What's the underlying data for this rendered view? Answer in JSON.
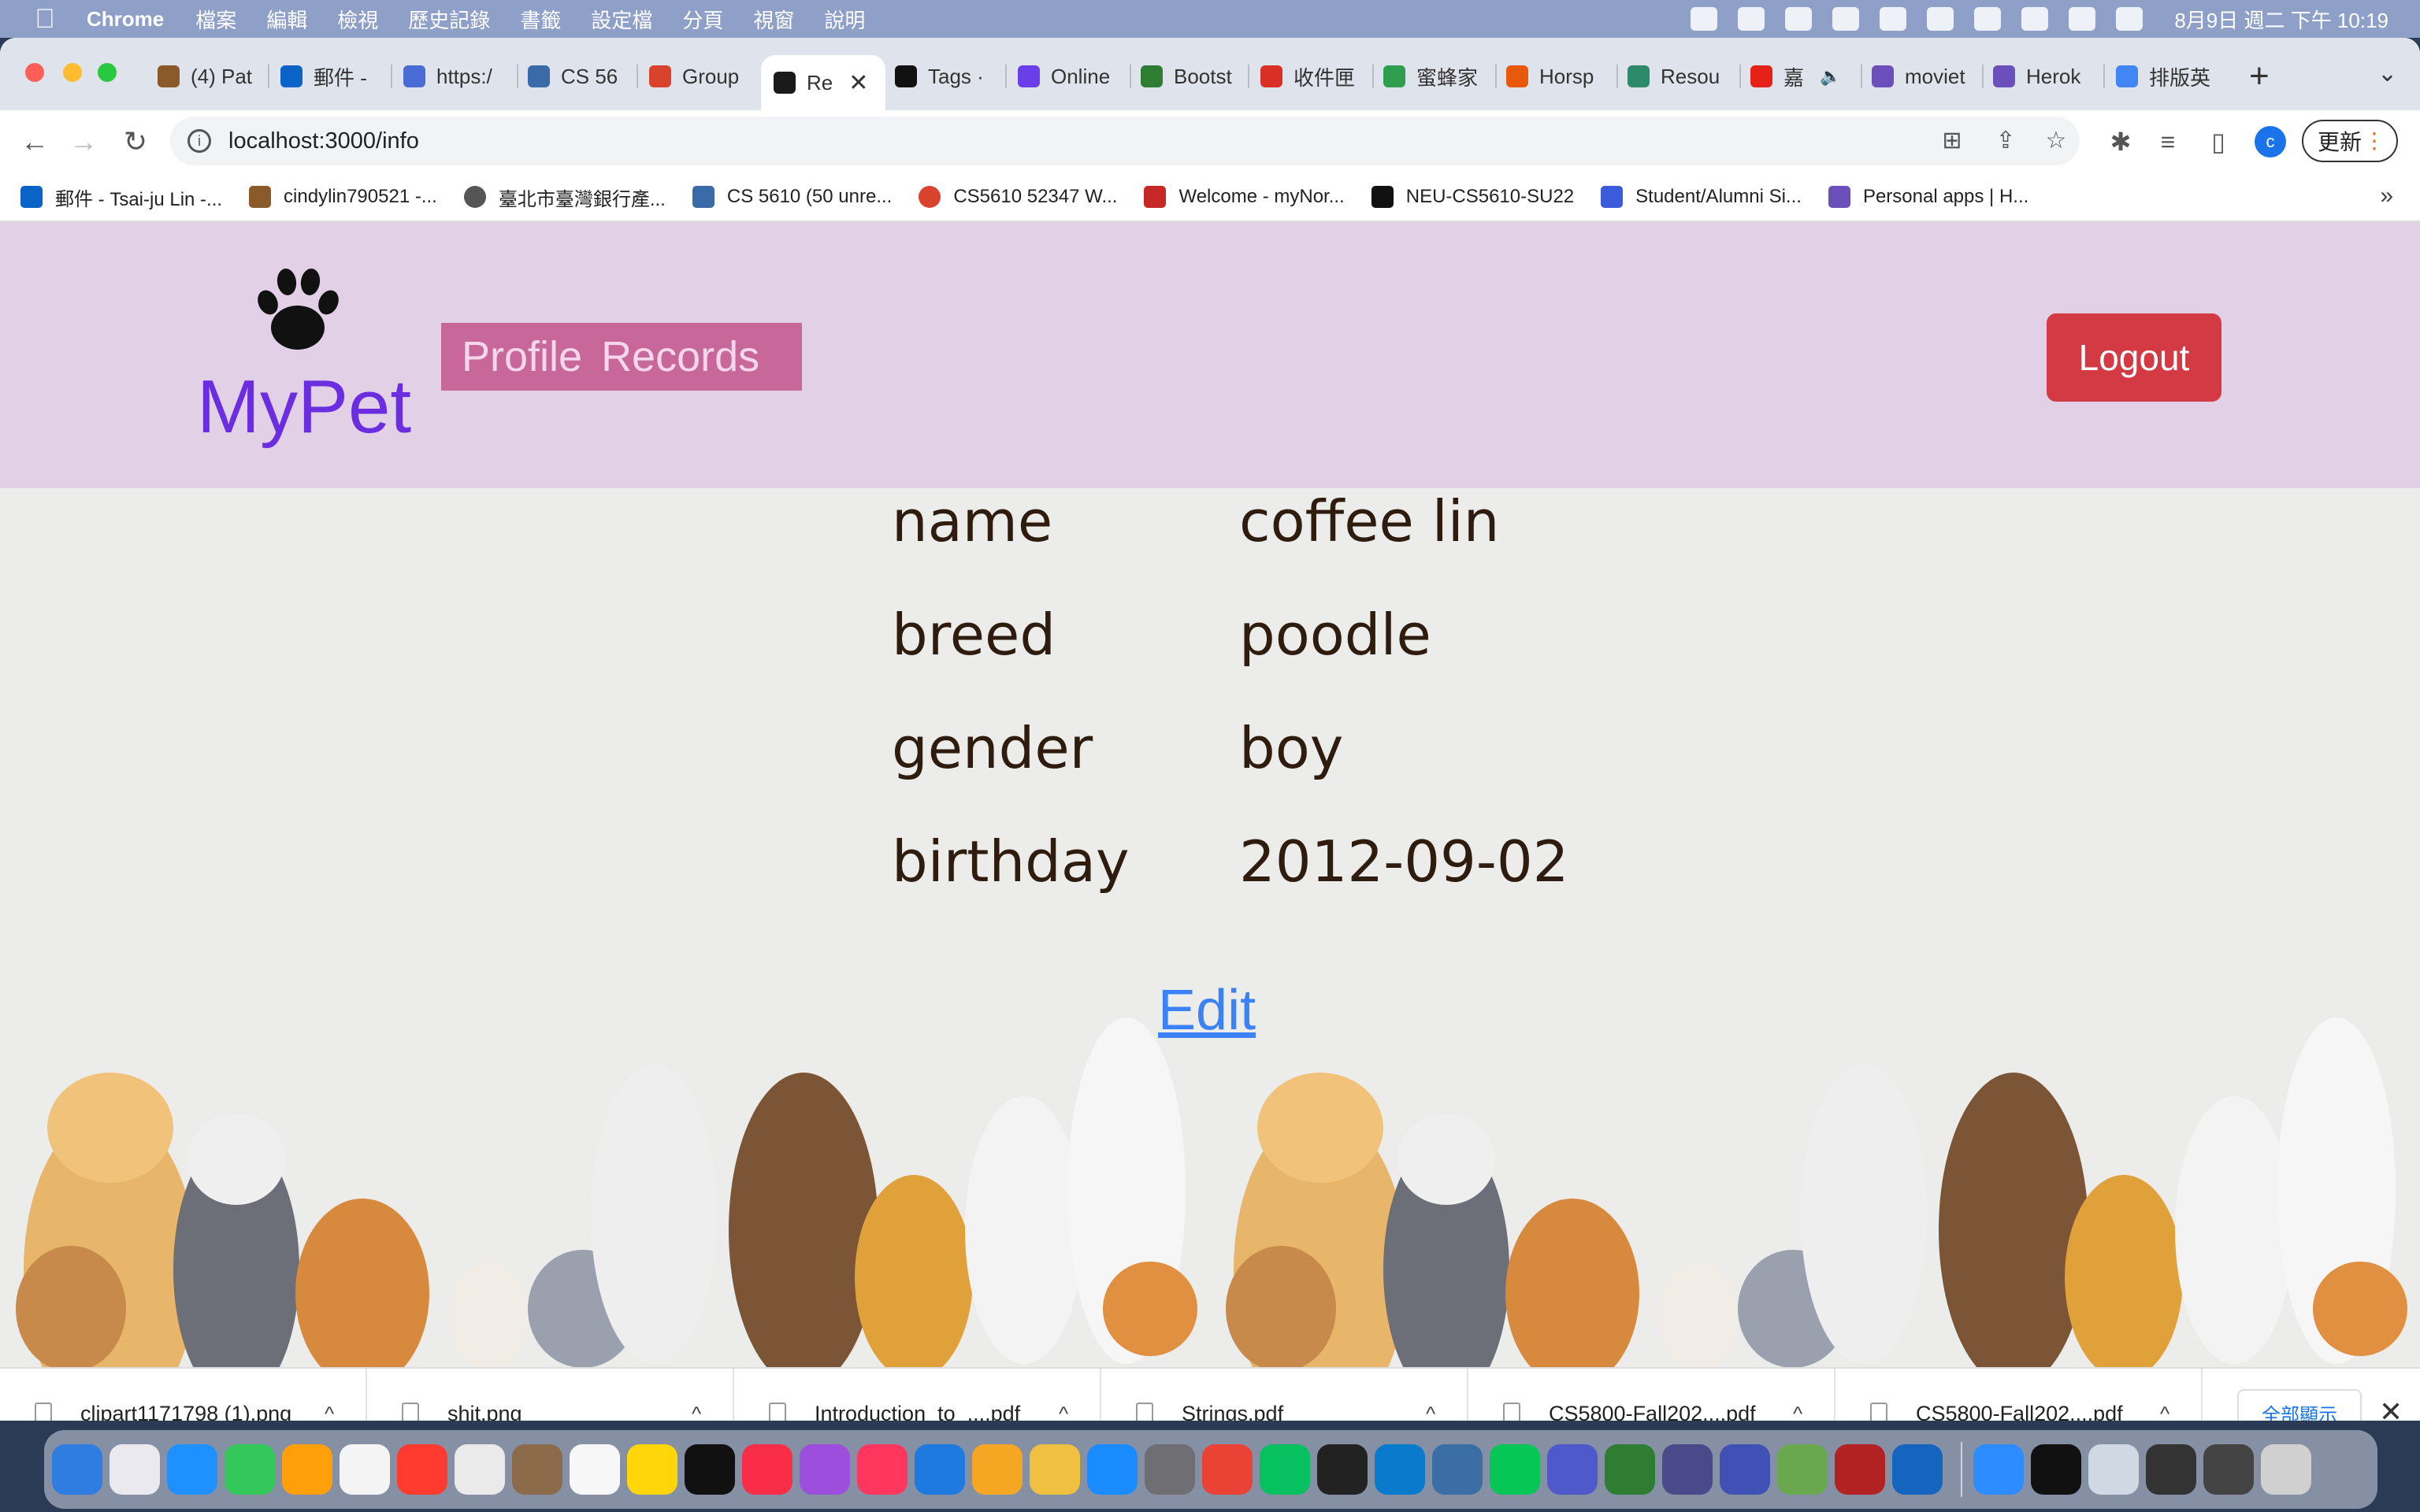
{
  "menubar": {
    "app_name": "Chrome",
    "items": [
      "檔案",
      "編輯",
      "檢視",
      "歷史記錄",
      "書籤",
      "設定檔",
      "分頁",
      "視窗",
      "說明"
    ],
    "clock": "8月9日 週二 下午 10:19"
  },
  "tabs": [
    {
      "label": "(4) Pat",
      "color": "#8b5a2b"
    },
    {
      "label": "郵件 -",
      "color": "#0a64c8"
    },
    {
      "label": "https:/",
      "color": "#4a6cd4"
    },
    {
      "label": "CS 56",
      "color": "#3a6aa8"
    },
    {
      "label": "Group",
      "color": "#d9432e"
    },
    {
      "label": "Re",
      "color": "#1a1a1a",
      "active": true
    },
    {
      "label": "Tags ·",
      "color": "#111111"
    },
    {
      "label": "Online",
      "color": "#6a3ee8"
    },
    {
      "label": "Bootst",
      "color": "#2e7d32"
    },
    {
      "label": "收件匣",
      "color": "#d93025"
    },
    {
      "label": "蜜蜂家",
      "color": "#2e9e4f"
    },
    {
      "label": "Horsp",
      "color": "#e8590c"
    },
    {
      "label": "Resou",
      "color": "#2d8a6a"
    },
    {
      "label": "嘉",
      "color": "#e62117"
    },
    {
      "label": "moviet",
      "color": "#6b4fbb"
    },
    {
      "label": "Herok",
      "color": "#6b4fbb"
    },
    {
      "label": "排版英",
      "color": "#4285f4"
    }
  ],
  "address_bar": {
    "url": "localhost:3000/info"
  },
  "update_button": "更新",
  "profile_initial": "c",
  "bookmarks": [
    {
      "label": "郵件 - Tsai-ju Lin -...",
      "color": "#0a64c8"
    },
    {
      "label": "cindylin790521 -...",
      "color": "#8b5a2b"
    },
    {
      "label": "臺北市臺灣銀行產...",
      "color": "#555555"
    },
    {
      "label": "CS 5610 (50 unre...",
      "color": "#3a6aa8"
    },
    {
      "label": "CS5610 52347 W...",
      "color": "#d9432e"
    },
    {
      "label": "Welcome - myNor...",
      "color": "#c62828"
    },
    {
      "label": "NEU-CS5610-SU22",
      "color": "#111111"
    },
    {
      "label": "Student/Alumni Si...",
      "color": "#3b5bdb"
    },
    {
      "label": "Personal apps | H...",
      "color": "#6b4fbb"
    }
  ],
  "site": {
    "logo_text": "MyPet",
    "nav": [
      "Profile",
      "Records"
    ],
    "logout": "Logout",
    "fields": [
      {
        "label": "name",
        "value": "coffee lin"
      },
      {
        "label": "breed",
        "value": "poodle"
      },
      {
        "label": "gender",
        "value": "boy"
      },
      {
        "label": "birthday",
        "value": "2012-09-02"
      }
    ],
    "edit": "Edit"
  },
  "downloads": [
    {
      "name": "clipart1171798 (1).png"
    },
    {
      "name": "shit.png"
    },
    {
      "name": "Introduction_to_....pdf"
    },
    {
      "name": "Strings.pdf"
    },
    {
      "name": "CS5800-Fall202....pdf"
    },
    {
      "name": "CS5800-Fall202....pdf"
    }
  ],
  "downloads_show_all": "全部顯示",
  "dock": {
    "colors": [
      "#2f7de1",
      "#e9e9ef",
      "#1e90ff",
      "#34c759",
      "#ff9f0a",
      "#f4f4f4",
      "#ff3b30",
      "#eaeaea",
      "#8b6b4a",
      "#f7f7f7",
      "#ffd60a",
      "#111111",
      "#fa2d48",
      "#9d4edd",
      "#ff375f",
      "#1f7ae0",
      "#f5a623",
      "#f0c040",
      "#1a8cff",
      "#6e6e73",
      "#ea4335",
      "#07c160",
      "#222222",
      "#0a7acc",
      "#3a6ea5",
      "#06c755",
      "#5059c9",
      "#2e7d32",
      "#4a4a8a",
      "#3f51b5",
      "#6aa84f",
      "#b22222",
      "#1565c0",
      "#2d8cff",
      "#111111",
      "#cfd8e3",
      "#333333",
      "#444444",
      "#d0d0d0"
    ]
  }
}
